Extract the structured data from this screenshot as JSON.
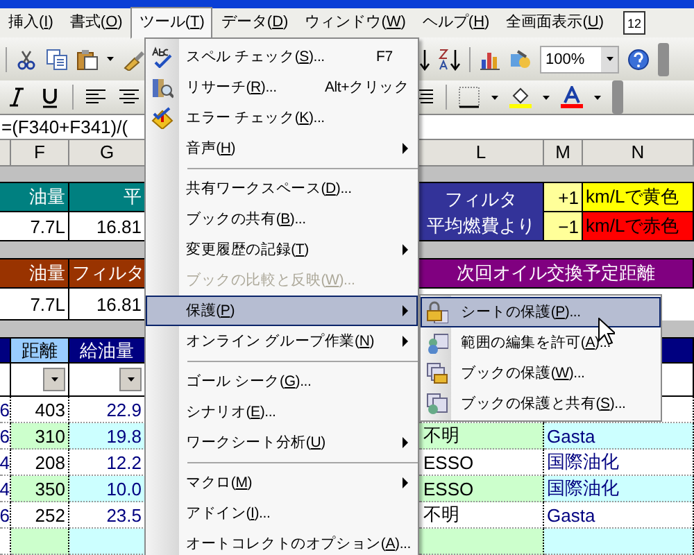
{
  "menu_bar": {
    "items": [
      {
        "label": "挿入(I)",
        "selected": false
      },
      {
        "label": "書式(O)",
        "selected": false
      },
      {
        "label": "ツール(T)",
        "selected": true
      },
      {
        "label": "データ(D)",
        "selected": false
      },
      {
        "label": "ウィンドウ(W)",
        "selected": false
      },
      {
        "label": "ヘルプ(H)",
        "selected": false
      },
      {
        "label": "全画面表示(U)",
        "selected": false
      }
    ],
    "date_badge": "12"
  },
  "toolbar": {
    "zoom": "100%"
  },
  "formula_bar": {
    "value": "=(F340+F341)/("
  },
  "column_headers": [
    "F",
    "G",
    "L",
    "M",
    "N"
  ],
  "fuel_summary": {
    "label_1": "油量",
    "label_2": "平",
    "value_1": "7.7L",
    "value_2": "16.81"
  },
  "highlight_rules": {
    "title_lines": [
      "フィルタ",
      "平均燃費より"
    ],
    "rules": [
      {
        "offset": "+1",
        "text": "km/Lで黄色",
        "color": "#ffff00"
      },
      {
        "offset": "−1",
        "text": "km/Lで赤色",
        "color": "#ff0000"
      }
    ]
  },
  "filter_summary": {
    "label_1": "油量",
    "label_2": "フィルタ",
    "value_1": "7.7L",
    "value_2": "16.81"
  },
  "oil_change": {
    "title": "次回オイル交換予定距離"
  },
  "log_table": {
    "columns": [
      "距離",
      "給油量"
    ],
    "rows": [
      {
        "col_e": "6",
        "distance": "403",
        "fuel": "22.9",
        "shaded": false
      },
      {
        "col_e": "6",
        "distance": "310",
        "fuel": "19.8",
        "station": "不明",
        "brand": "Gasta",
        "shaded": true
      },
      {
        "col_e": "4",
        "distance": "208",
        "fuel": "12.2",
        "station": "ESSO",
        "brand": "国際油化",
        "shaded": false
      },
      {
        "col_e": "4",
        "distance": "350",
        "fuel": "10.0",
        "station": "ESSO",
        "brand": "国際油化",
        "shaded": true
      },
      {
        "col_e": "6",
        "distance": "252",
        "fuel": "23.5",
        "station": "不明",
        "brand": "Gasta",
        "shaded": false
      },
      {
        "shaded": true
      }
    ]
  },
  "tools_menu": {
    "items": [
      {
        "kind": "item",
        "label": "スペル チェック(S)...",
        "shortcut": "F7",
        "submenu": false,
        "disabled": false,
        "selected": false
      },
      {
        "kind": "item",
        "label": "リサーチ(R)...",
        "shortcut": "Alt+クリック",
        "submenu": false,
        "disabled": false,
        "selected": false
      },
      {
        "kind": "item",
        "label": "エラー チェック(K)...",
        "submenu": false,
        "disabled": false,
        "selected": false
      },
      {
        "kind": "item",
        "label": "音声(H)",
        "submenu": true,
        "disabled": false,
        "selected": false
      },
      {
        "kind": "separator"
      },
      {
        "kind": "item",
        "label": "共有ワークスペース(D)...",
        "submenu": false,
        "disabled": false,
        "selected": false
      },
      {
        "kind": "item",
        "label": "ブックの共有(B)...",
        "submenu": false,
        "disabled": false,
        "selected": false
      },
      {
        "kind": "item",
        "label": "変更履歴の記録(T)",
        "submenu": true,
        "disabled": false,
        "selected": false
      },
      {
        "kind": "item",
        "label": "ブックの比較と反映(W)...",
        "submenu": false,
        "disabled": true,
        "selected": false
      },
      {
        "kind": "item",
        "label": "保護(P)",
        "submenu": true,
        "disabled": false,
        "selected": true
      },
      {
        "kind": "item",
        "label": "オンライン グループ作業(N)",
        "submenu": true,
        "disabled": false,
        "selected": false
      },
      {
        "kind": "separator"
      },
      {
        "kind": "item",
        "label": "ゴール シーク(G)...",
        "submenu": false,
        "disabled": false,
        "selected": false
      },
      {
        "kind": "item",
        "label": "シナリオ(E)...",
        "submenu": false,
        "disabled": false,
        "selected": false
      },
      {
        "kind": "item",
        "label": "ワークシート分析(U)",
        "submenu": true,
        "disabled": false,
        "selected": false
      },
      {
        "kind": "separator"
      },
      {
        "kind": "item",
        "label": "マクロ(M)",
        "submenu": true,
        "disabled": false,
        "selected": false
      },
      {
        "kind": "item",
        "label": "アドイン(I)...",
        "submenu": false,
        "disabled": false,
        "selected": false
      },
      {
        "kind": "item",
        "label": "オートコレクトのオプション(A)...",
        "submenu": false,
        "disabled": false,
        "selected": false
      }
    ]
  },
  "protection_menu": {
    "items": [
      {
        "label": "シートの保護(P)...",
        "selected": true
      },
      {
        "label": "範囲の編集を許可(A)...",
        "selected": false
      },
      {
        "label": "ブックの保護(W)...",
        "selected": false
      },
      {
        "label": "ブックの保護と共有(S)...",
        "selected": false
      }
    ]
  }
}
